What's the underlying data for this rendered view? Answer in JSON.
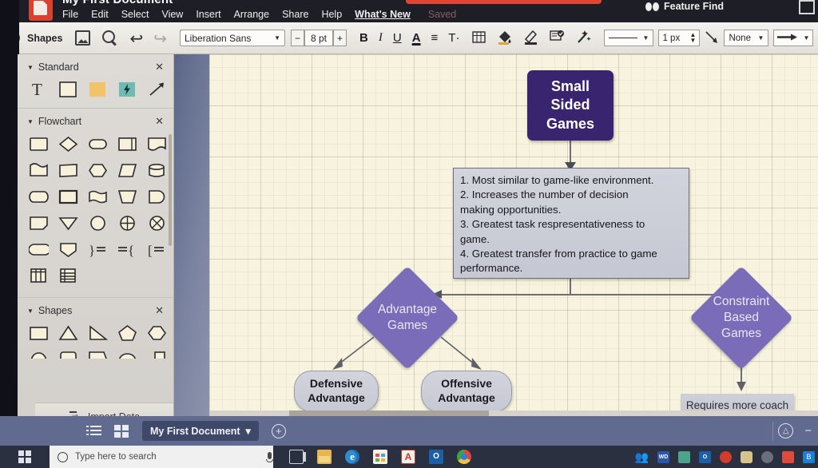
{
  "window": {
    "title": "My First Document",
    "menu": [
      "File",
      "Edit",
      "Select",
      "View",
      "Insert",
      "Arrange",
      "Share",
      "Help"
    ],
    "whats_new": "What's New",
    "saved_label": "Saved",
    "feature_find": "Feature Find"
  },
  "toolbar": {
    "shapes_label": "Shapes",
    "font_family": "Liberation Sans",
    "font_size": "8 pt",
    "minus": "−",
    "plus": "+",
    "bold": "B",
    "italic": "I",
    "underline": "U",
    "font_color": "A",
    "align": "≡",
    "text_opts": "T·",
    "line_width": "1 px",
    "fill_none": "None",
    "undo": "↩",
    "redo": "↪"
  },
  "left_panel": {
    "sections": [
      {
        "title": "Standard",
        "close": "✕"
      },
      {
        "title": "Flowchart",
        "close": "✕"
      },
      {
        "title": "Shapes",
        "close": "✕"
      }
    ],
    "import_data": "Import Data"
  },
  "canvas": {
    "nodes": {
      "root": "Small Sided Games",
      "root_lines": [
        "Small",
        "Sided",
        "Games"
      ],
      "notes": [
        "1. Most similar to game-like environment.",
        "2. Increases the number of decision",
        "making opportunities.",
        "3. Greatest task respresentativeness to",
        "game.",
        "4. Greatest transfer from practice to game",
        "performance."
      ],
      "advantage_games": "Advantage Games",
      "constraint_based_games": "Constraint Based Games",
      "defensive_advantage": "Defensive Advantage",
      "offensive_advantage": "Offensive Advantage",
      "requires_more": "Requires more coach led instruction"
    },
    "colors": {
      "root_fill": "#39246f",
      "diamond_fill": "#7a6cb8",
      "pill_fill": "#cbcdd8",
      "background": "#f7f3de"
    }
  },
  "statusbar": {
    "document_tab": "My First Document",
    "tab_caret": "▾",
    "add": "+",
    "zoom_reset": "△",
    "zoom_out": "−"
  },
  "taskbar": {
    "search_placeholder": "Type here to search",
    "apps": [
      "task-view",
      "file-explorer",
      "edge",
      "microsoft-store",
      "adobe-acrobat",
      "outlook",
      "chrome"
    ],
    "tray": [
      "people",
      "western-digital",
      "green-app",
      "outlook",
      "red-app",
      "cloud",
      "network",
      "security-shield",
      "bluetooth"
    ]
  }
}
